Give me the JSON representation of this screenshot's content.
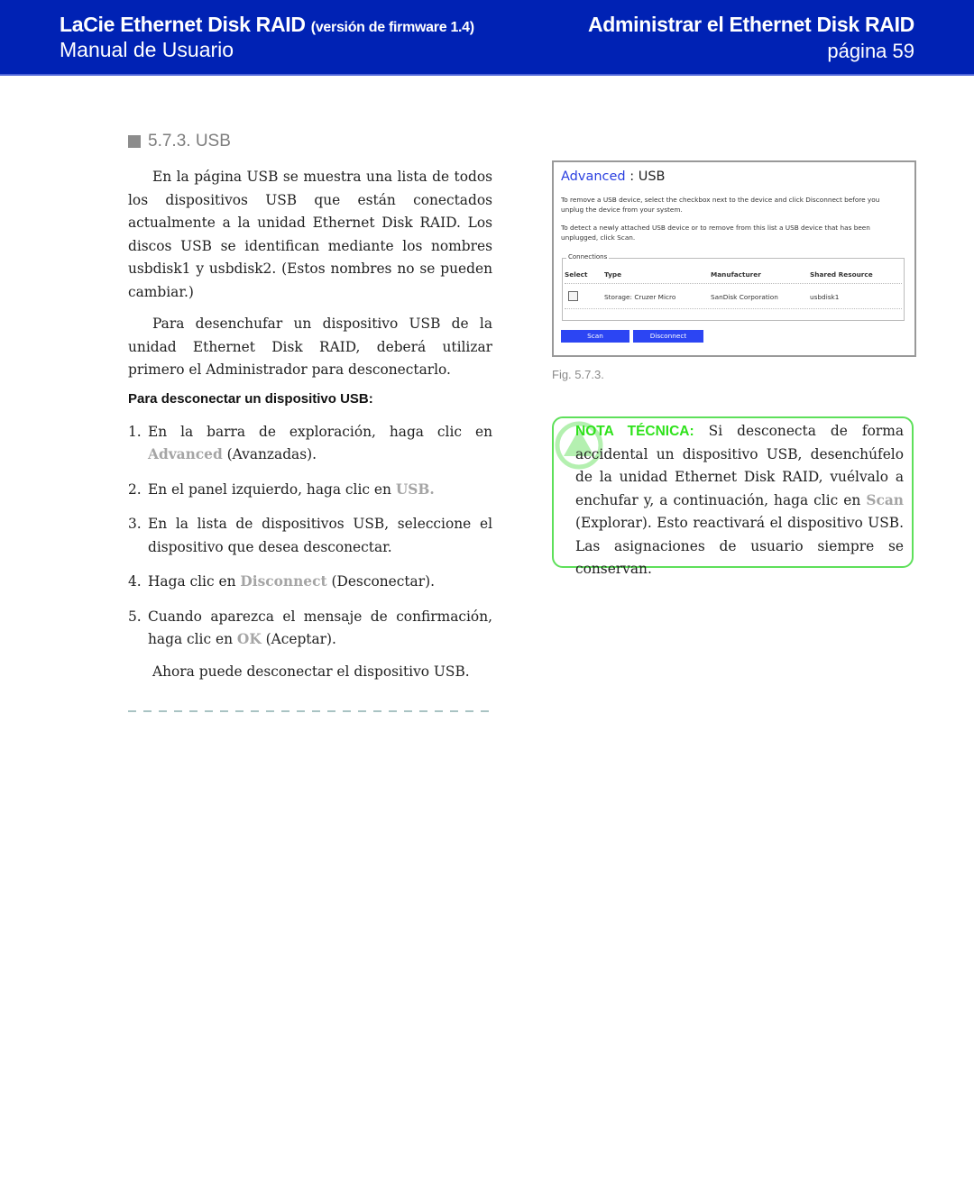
{
  "header": {
    "product": "LaCie Ethernet Disk RAID",
    "firmware": "(versión de firmware 1.4)",
    "manual": "Manual de Usuario",
    "chapter": "Administrar el Ethernet Disk RAID",
    "page": "página 59"
  },
  "colors": {
    "header_bg": "#0022b4",
    "note_green": "#5ee05a",
    "highlight_gray": "#a5a5a5",
    "button_blue": "#2c45f3"
  },
  "section": {
    "title": "5.7.3. USB",
    "para1": "En la página USB se muestra una lista de todos los dispositivos USB que están conectados actualmente a la unidad Ethernet Disk RAID. Los discos USB se identifican mediante los nombres usbdisk1 y usbdisk2. (Estos nombres no se pueden cambiar.)",
    "para2": "Para desenchufar un dispositivo USB de la unidad Ethernet Disk RAID, deberá utilizar primero el Administrador para desconectarlo.",
    "procedure_title": "Para desconectar un dispositivo USB:",
    "steps": [
      {
        "num": "1.",
        "pre": "En la barra de exploración, haga clic en ",
        "hl": "Advanced",
        "post": " (Avanzadas)."
      },
      {
        "num": "2.",
        "pre": "En el panel izquierdo, haga clic en ",
        "hl": "USB.",
        "post": ""
      },
      {
        "num": "3.",
        "pre": "En la lista de dispositivos USB, seleccione el dispositivo que desea desconectar.",
        "hl": "",
        "post": ""
      },
      {
        "num": "4.",
        "pre": "Haga clic en ",
        "hl": "Disconnect",
        "post": " (Desconectar)."
      },
      {
        "num": "5.",
        "pre": "Cuando aparezca el mensaje de confirmación, haga clic en ",
        "hl": "OK",
        "post": " (Aceptar)."
      }
    ],
    "final": "Ahora puede desconectar el dispositivo USB."
  },
  "screenshot": {
    "title_link": "Advanced",
    "title_rest": " : USB",
    "text1": "To remove a USB device, select the checkbox next to the device and click Disconnect before you unplug the device from your system.",
    "text2": "To detect a newly attached USB device or to remove from this list a USB device that has been unplugged, click Scan.",
    "fieldset_legend": "Connections",
    "columns": [
      "Select",
      "Type",
      "Manufacturer",
      "Shared Resource"
    ],
    "rows": [
      {
        "selected": false,
        "type": "Storage: Cruzer Micro",
        "manufacturer": "SanDisk Corporation",
        "resource": "usbdisk1"
      }
    ],
    "scan_button": "Scan",
    "disconnect_button": "Disconnect"
  },
  "figure_caption": "Fig. 5.7.3.",
  "note": {
    "icon": "info-triangle-icon",
    "label": "NOTA TÉCNICA:",
    "pre": " Si desconecta de forma accidental un dispositivo USB, desenchúfelo de la unidad Ethernet Disk RAID, vuélvalo a enchufar y, a continuación, haga clic en ",
    "hl": "Scan",
    "post": " (Explorar). Esto reactivará el dispositivo USB. Las asignaciones de usuario siempre se conservan."
  }
}
